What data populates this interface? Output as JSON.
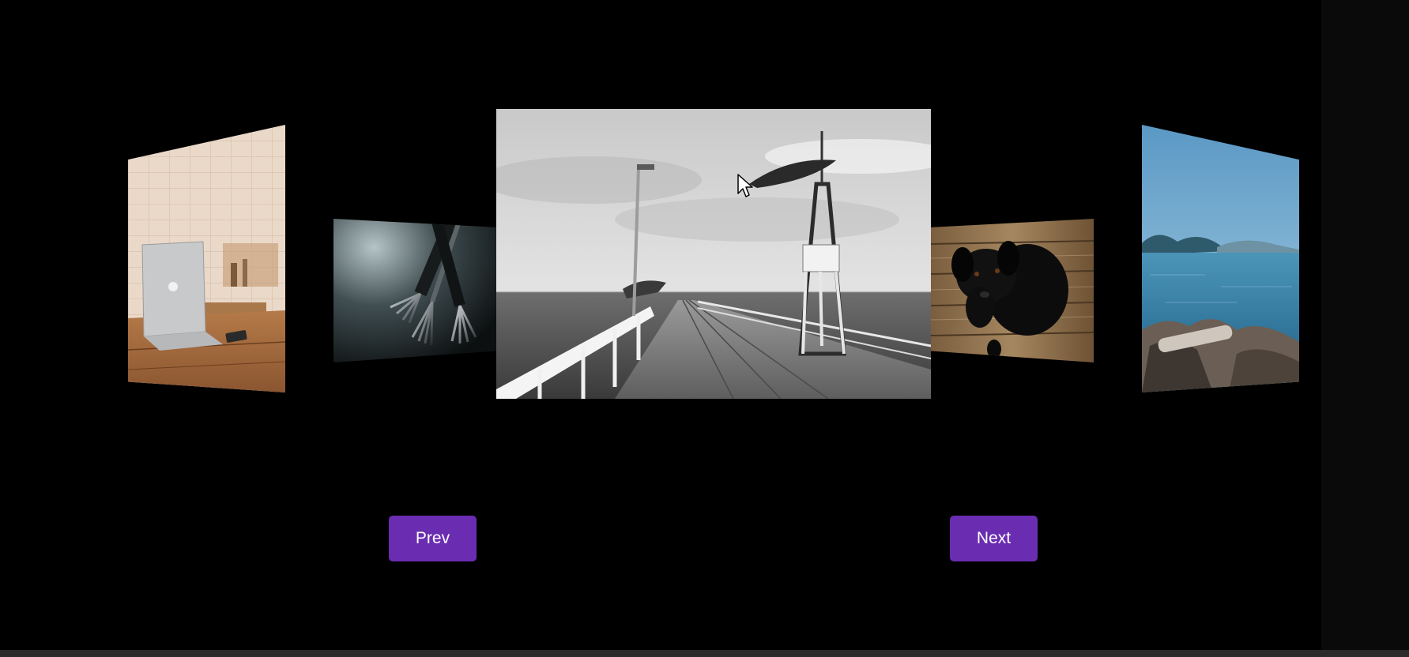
{
  "carousel": {
    "slides": [
      {
        "name": "laptop-on-desk"
      },
      {
        "name": "silver-forks"
      },
      {
        "name": "pier-with-lighthouse",
        "active": true
      },
      {
        "name": "black-dog-on-wood"
      },
      {
        "name": "coastal-sea-rocks"
      }
    ],
    "prev_label": "Prev",
    "next_label": "Next"
  },
  "colors": {
    "background": "#000000",
    "button": "#6a2db1",
    "button_text": "#ffffff"
  },
  "icons": {
    "cursor": "mouse-pointer-icon"
  }
}
